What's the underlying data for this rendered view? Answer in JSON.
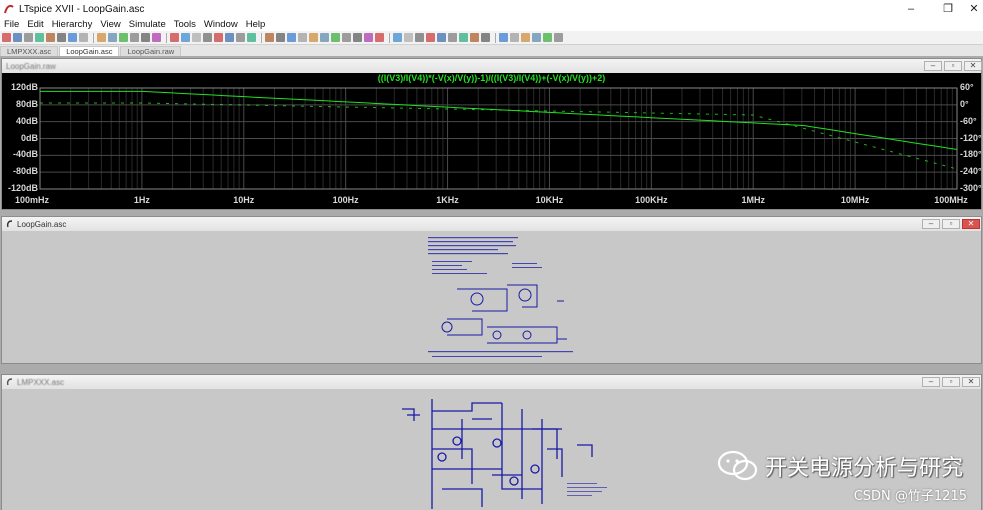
{
  "app": {
    "title": "LTspice XVII - LoopGain.asc"
  },
  "window_controls": {
    "minimize": "–",
    "restore": "❐",
    "close": "✕"
  },
  "menu": [
    "File",
    "Edit",
    "Hierarchy",
    "View",
    "Simulate",
    "Tools",
    "Window",
    "Help"
  ],
  "tabs": [
    {
      "label": "LMPXXX.asc"
    },
    {
      "label": "LoopGain.asc"
    },
    {
      "label": "LoopGain.raw"
    }
  ],
  "plot_window": {
    "caption": "LoopGain.raw",
    "expression": "((I(V3)/I(V4))*(-V(x)/V(y))-1)/((I(V3)/I(V4))+(-V(x)/V(y))+2)",
    "left_axis": [
      "120dB",
      "80dB",
      "40dB",
      "0dB",
      "-40dB",
      "-80dB",
      "-120dB"
    ],
    "right_axis": [
      "60°",
      "0°",
      "-60°",
      "-120°",
      "-180°",
      "-240°",
      "-300°"
    ],
    "x_axis": [
      "100mHz",
      "1Hz",
      "10Hz",
      "100Hz",
      "1KHz",
      "10KHz",
      "100KHz",
      "1MHz",
      "10MHz",
      "100MHz"
    ],
    "trace_color": "#22e022"
  },
  "loopgain_window": {
    "caption": "LoopGain.asc"
  },
  "lmp_window": {
    "caption": "LMPXXX.asc"
  },
  "watermark": {
    "text": "开关电源分析与研究",
    "credit": "CSDN @竹子1215"
  },
  "colors": {
    "plot_bg": "#000000",
    "grid": "#3a3a3a",
    "schematic_wire": "#1a1aa8"
  }
}
